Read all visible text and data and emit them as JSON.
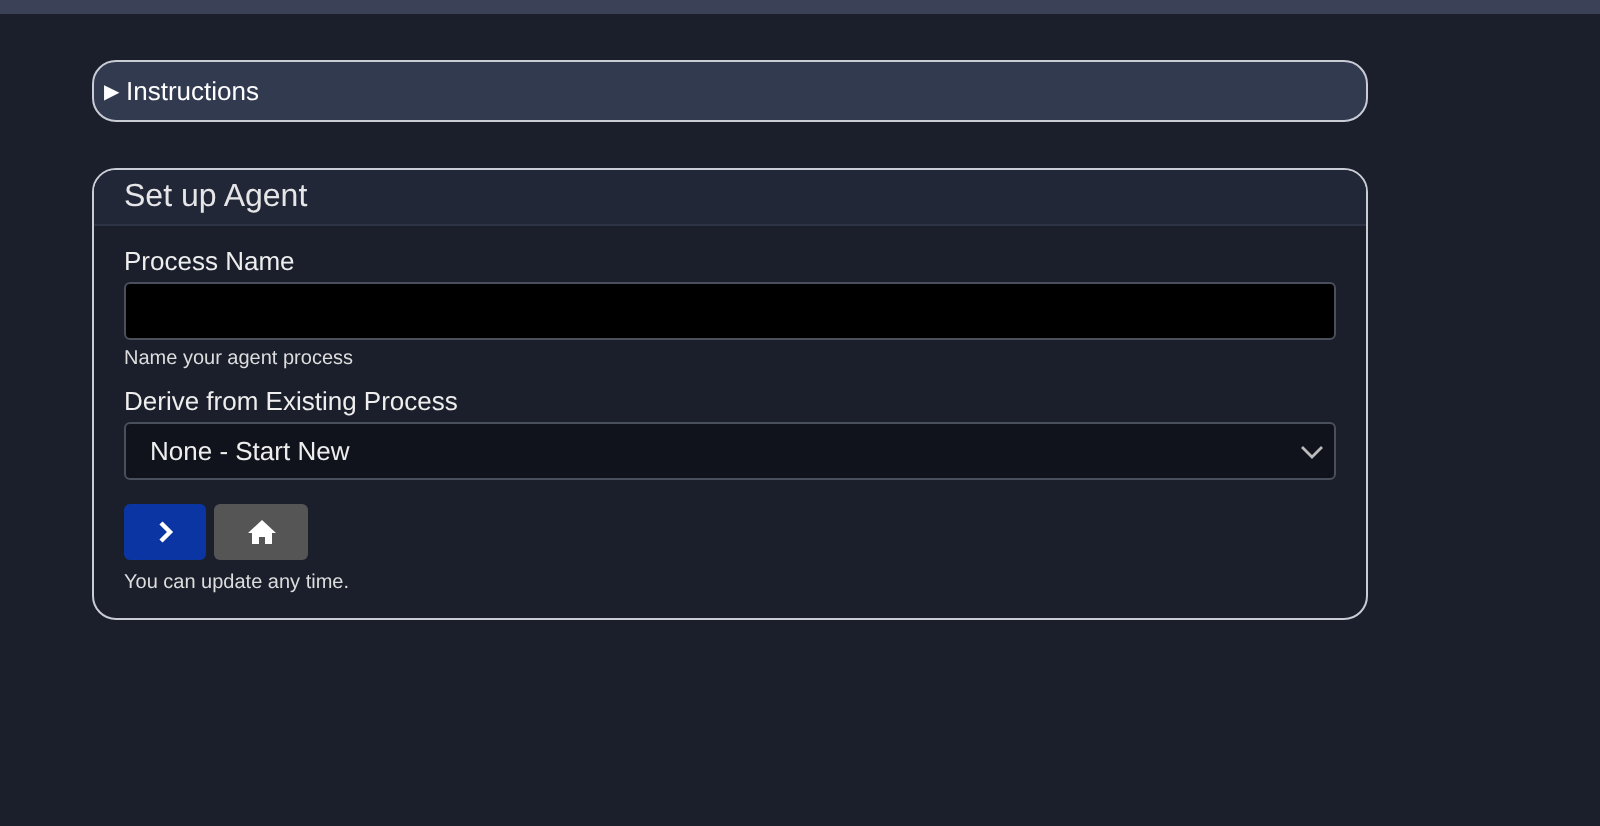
{
  "instructions": {
    "marker": "▶",
    "label": "Instructions",
    "expanded": false
  },
  "card": {
    "title": "Set up Agent",
    "fields": [
      {
        "kind": "text",
        "label": "Process Name",
        "help": "Name your agent process"
      },
      {
        "kind": "select",
        "label": "Derive from Existing Process",
        "value": "None - Start New"
      }
    ],
    "buttons": [
      {
        "kind": "next"
      },
      {
        "kind": "home"
      }
    ],
    "note": "You can update any time."
  }
}
